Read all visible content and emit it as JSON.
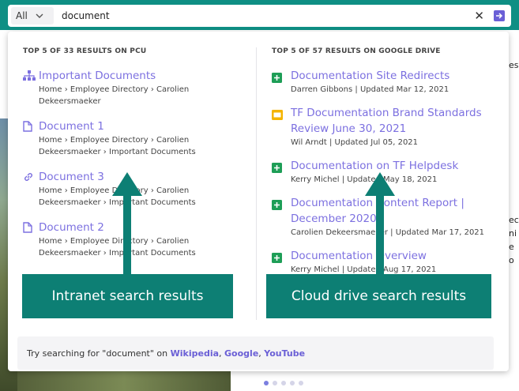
{
  "search": {
    "scope": "All",
    "query": "document"
  },
  "left": {
    "header": "TOP 5 OF 33 RESULTS ON PCU",
    "results": [
      {
        "icon": "org-chart-icon",
        "title": "Important Documents",
        "meta": "Home › Employee Directory › Carolien Dekeersmaeker"
      },
      {
        "icon": "document-icon",
        "title": "Document 1",
        "meta": "Home › Employee Directory › Carolien Dekeersmaeker › Important Documents"
      },
      {
        "icon": "link-icon",
        "title": "Document 3",
        "meta": "Home › Employee Directory › Carolien Dekeersmaeker › Important Documents"
      },
      {
        "icon": "document-icon",
        "title": "Document 2",
        "meta": "Home › Employee Directory › Carolien Dekeersmaeker › Important Documents"
      }
    ]
  },
  "right": {
    "header": "TOP 5 OF 57 RESULTS ON GOOGLE DRIVE",
    "results": [
      {
        "icon": "google-sheets-icon",
        "title": "Documentation Site Redirects",
        "meta": "Darren Gibbons | Updated Mar 12, 2021"
      },
      {
        "icon": "google-slides-icon",
        "title": "TF Documentation Brand Standards Review June 30, 2021",
        "meta": "Wil Arndt | Updated Jul 05, 2021"
      },
      {
        "icon": "google-sheets-icon",
        "title": "Documentation on TF Helpdesk",
        "meta": "Kerry Michel | Updated May 18, 2021"
      },
      {
        "icon": "google-sheets-icon",
        "title": "Documentation Content Report | December 2020",
        "meta": "Carolien Dekeersmaeker | Updated Mar 17, 2021"
      },
      {
        "icon": "google-sheets-icon",
        "title": "Documentation Overview",
        "meta": "Kerry Michel | Updated Aug 17, 2021"
      }
    ]
  },
  "footer": {
    "prefix": "Try searching for \"document\" on ",
    "links": [
      "Wikipedia",
      "Google",
      "YouTube"
    ]
  },
  "annotations": {
    "left": "Intranet search results",
    "right": "Cloud drive search results"
  },
  "background": {
    "right_edge_text": [
      "eso",
      "ec",
      "ni",
      "e",
      "o"
    ]
  },
  "colors": {
    "accent": "#7c70e0",
    "teal": "#0f8f84",
    "callout": "#0d7f74",
    "sheets_green": "#1e9e57",
    "slides_yellow": "#f4b400"
  }
}
